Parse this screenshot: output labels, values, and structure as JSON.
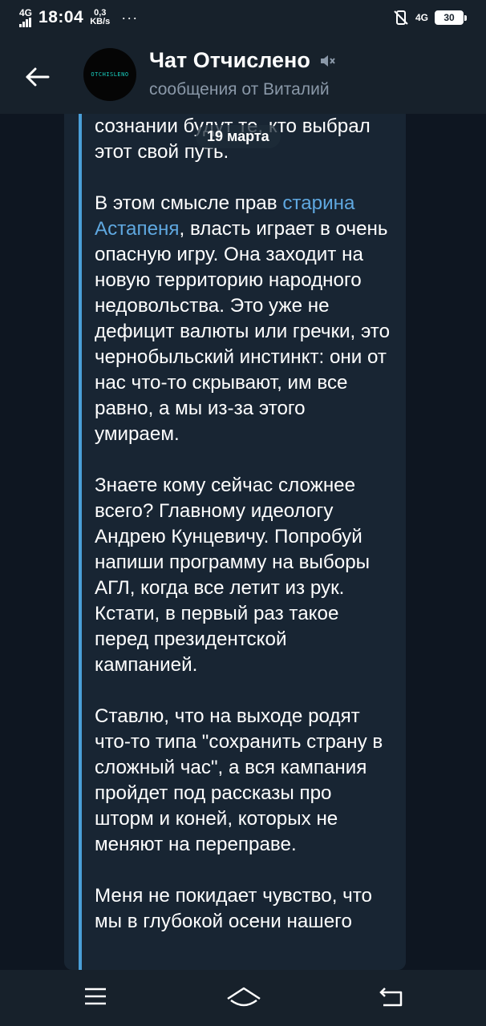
{
  "status_bar": {
    "network_left": "4G",
    "time": "18:04",
    "speed_value": "0,3",
    "speed_unit": "KB/s",
    "more": "···",
    "network_right": "4G",
    "battery": "30"
  },
  "header": {
    "title": "Чат Отчислено",
    "subtitle": "сообщения от Виталий",
    "avatar_text": "OTCHISLENO",
    "muted_icon": "muted-speaker-icon"
  },
  "date_badge": "19 марта",
  "message": {
    "paragraphs": [
      [
        {
          "text": "сознании будут те, кто выбрал этот свой путь."
        }
      ],
      [
        {
          "text": "В этом смысле прав "
        },
        {
          "text": "старина Астапеня",
          "link": true
        },
        {
          "text": ", власть играет в очень опасную игру. Она заходит на новую территорию народного недовольства. Это уже не дефицит валюты или гречки, это чернобыльский инстинкт: они от нас что-то скрывают, им все равно, а мы из-за этого умираем."
        }
      ],
      [
        {
          "text": "Знаете кому сейчас сложнее всего? Главному идеологу Андрею Кунцевичу. Попробуй напиши программу на выборы АГЛ, когда все летит из рук. Кстати, в первый раз такое перед президентской кампанией."
        }
      ],
      [
        {
          "text": "Ставлю, что на выходе родят что-то типа \"сохранить страну в сложный час\", а вся кампания пройдет под рассказы про шторм и коней, которых не меняют на переправе."
        }
      ],
      [
        {
          "text": "Меня не покидает чувство, что мы в глубокой осени нашего"
        }
      ]
    ]
  },
  "colors": {
    "background": "#0e1621",
    "bar": "#17212b",
    "bubble": "#182533",
    "link": "#5fa8e0",
    "quote_bar": "#4a9fd8",
    "subtitle": "#8a98a8"
  },
  "nav": {
    "icons": [
      "menu-icon",
      "home-icon",
      "back-icon"
    ]
  }
}
